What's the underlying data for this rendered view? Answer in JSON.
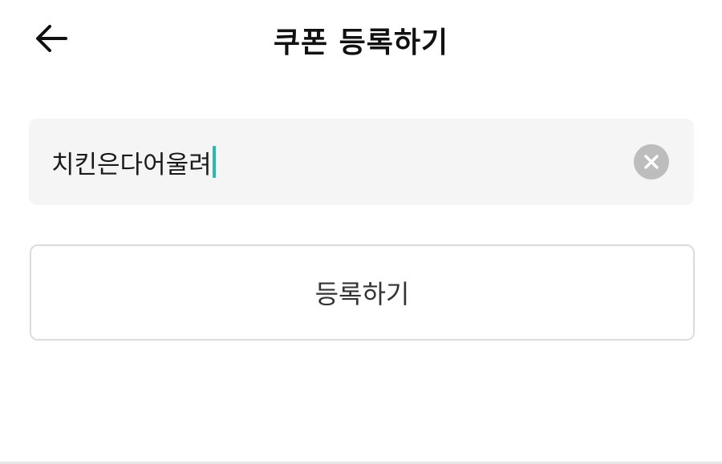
{
  "header": {
    "title": "쿠폰 등록하기",
    "back_icon": "arrow-left-icon"
  },
  "coupon_field": {
    "value": "치킨은다어울려",
    "clear_icon": "clear-circle-icon"
  },
  "register_button": {
    "label": "등록하기"
  },
  "colors": {
    "caret": "#2fb8b0",
    "field_bg": "#f5f5f5",
    "clear_icon_bg": "#bdbdbd",
    "button_border": "#dcdcdc"
  }
}
